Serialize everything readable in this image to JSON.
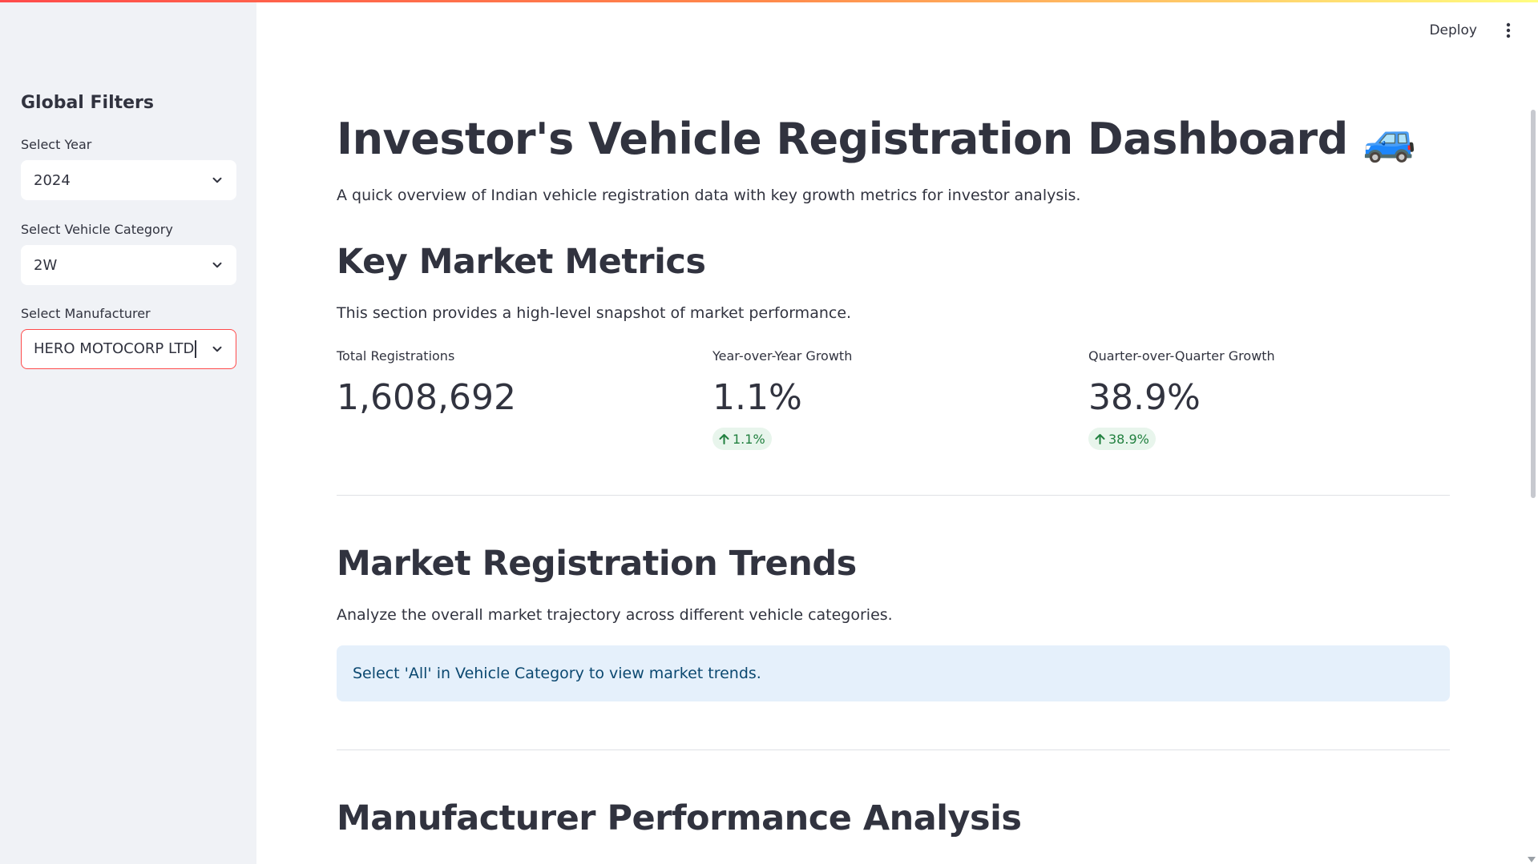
{
  "header": {
    "deploy_label": "Deploy",
    "menu_icon": "kebab-menu-icon"
  },
  "sidebar": {
    "title": "Global Filters",
    "filters": [
      {
        "label": "Select Year",
        "value": "2024"
      },
      {
        "label": "Select Vehicle Category",
        "value": "2W"
      },
      {
        "label": "Select Manufacturer",
        "value": "HERO MOTOCORP LTD"
      }
    ]
  },
  "main": {
    "title": "Investor's Vehicle Registration Dashboard",
    "title_emoji": "🚙",
    "intro": "A quick overview of Indian vehicle registration data with key growth metrics for investor analysis.",
    "key_metrics": {
      "heading": "Key Market Metrics",
      "description": "This section provides a high-level snapshot of market performance.",
      "metrics": [
        {
          "label": "Total Registrations",
          "value": "1,608,692"
        },
        {
          "label": "Year-over-Year Growth",
          "value": "1.1%",
          "delta": "1.1%"
        },
        {
          "label": "Quarter-over-Quarter Growth",
          "value": "38.9%",
          "delta": "38.9%"
        }
      ]
    },
    "trends": {
      "heading": "Market Registration Trends",
      "description": "Analyze the overall market trajectory across different vehicle categories.",
      "info": "Select 'All' in Vehicle Category to view market trends."
    },
    "manufacturer": {
      "heading": "Manufacturer Performance Analysis"
    }
  },
  "colors": {
    "accent": "#ff4b4b",
    "positive": "#21803f",
    "positive_bg": "#e8f5ec",
    "info_bg": "#e5f0fb",
    "info_text": "#0b4870",
    "sidebar_bg": "#f0f2f6"
  }
}
